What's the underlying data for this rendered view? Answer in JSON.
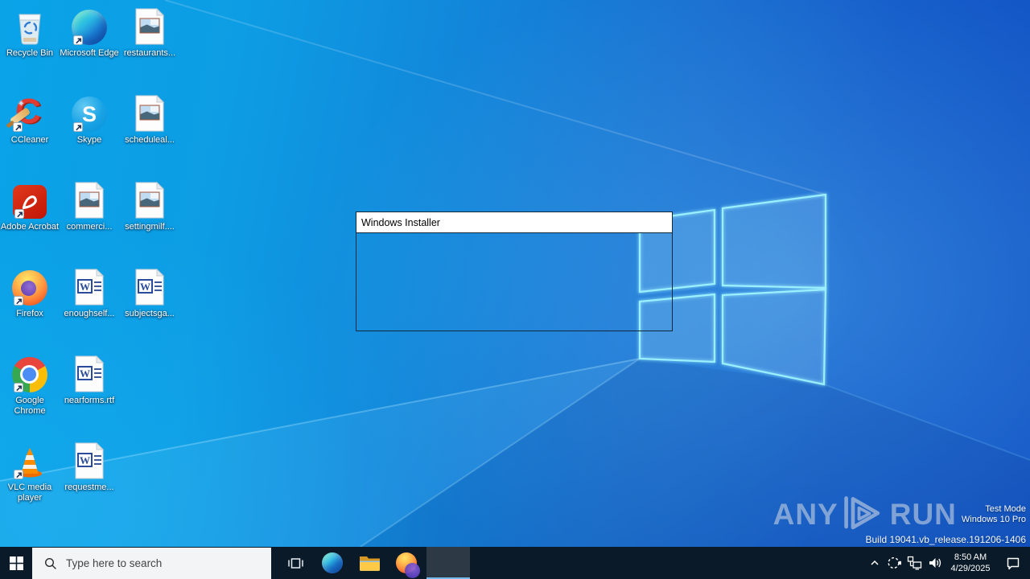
{
  "desktop": {
    "icons": [
      {
        "label": "Recycle Bin",
        "icon": "recycle-bin-icon",
        "shortcut": false
      },
      {
        "label": "Microsoft Edge",
        "icon": "edge-icon",
        "shortcut": true
      },
      {
        "label": "restaurants...",
        "icon": "image-file-icon",
        "shortcut": false
      },
      {
        "label": "CCleaner",
        "icon": "ccleaner-icon",
        "shortcut": true
      },
      {
        "label": "Skype",
        "icon": "skype-icon",
        "shortcut": true
      },
      {
        "label": "scheduleal...",
        "icon": "image-file-icon",
        "shortcut": false
      },
      {
        "label": "Adobe Acrobat",
        "icon": "acrobat-icon",
        "shortcut": true
      },
      {
        "label": "commerci...",
        "icon": "image-file-icon",
        "shortcut": false
      },
      {
        "label": "settingmilf....",
        "icon": "image-file-icon",
        "shortcut": false
      },
      {
        "label": "Firefox",
        "icon": "firefox-icon",
        "shortcut": true
      },
      {
        "label": "enoughself...",
        "icon": "word-file-icon",
        "shortcut": false
      },
      {
        "label": "subjectsga...",
        "icon": "word-file-icon",
        "shortcut": false
      },
      {
        "label": "Google Chrome",
        "icon": "chrome-icon",
        "shortcut": true
      },
      {
        "label": "nearforms.rtf",
        "icon": "word-file-icon",
        "shortcut": false
      },
      {
        "label": "VLC media player",
        "icon": "vlc-icon",
        "shortcut": true
      },
      {
        "label": "requestme...",
        "icon": "word-file-icon",
        "shortcut": false
      }
    ],
    "skype_letter": "S",
    "ccleaner_letter": "C",
    "word_letter": "W"
  },
  "installer_window": {
    "title": "Windows Installer"
  },
  "watermark": {
    "brand_any": "ANY",
    "brand_run": "RUN",
    "test_mode": "Test Mode",
    "os_edition": "Windows 10 Pro",
    "build": "Build 19041.vb_release.191206-1406"
  },
  "taskbar": {
    "search_placeholder": "Type here to search",
    "clock": {
      "time": "8:50 AM",
      "date": "4/29/2025"
    }
  },
  "colors": {
    "taskbar_bg": "#0b1a28",
    "active_underline": "#76b9ed",
    "wallpaper_left": "#0aa3e8",
    "wallpaper_right": "#1253c4",
    "window_glow": "#9af0ff"
  }
}
